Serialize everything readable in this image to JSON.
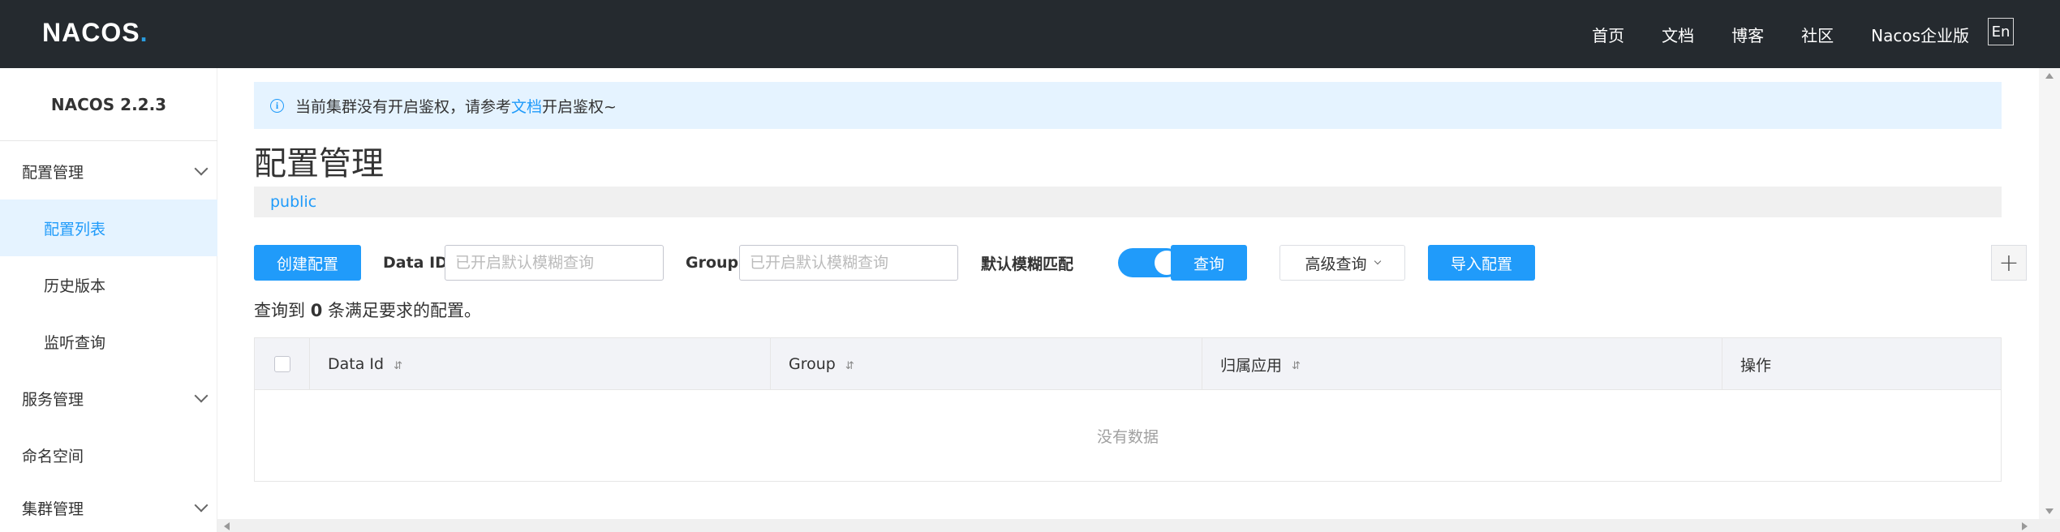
{
  "header": {
    "logo_prefix": "NACOS",
    "logo_suffix": ".",
    "nav": [
      "首页",
      "文档",
      "博客",
      "社区",
      "Nacos企业版"
    ],
    "lang_button": "En"
  },
  "sidebar": {
    "version": "NACOS 2.2.3",
    "items": [
      {
        "label": "配置管理",
        "type": "group",
        "expandable": true
      },
      {
        "label": "配置列表",
        "type": "item",
        "active": true
      },
      {
        "label": "历史版本",
        "type": "item"
      },
      {
        "label": "监听查询",
        "type": "item"
      },
      {
        "label": "服务管理",
        "type": "group",
        "expandable": true
      },
      {
        "label": "命名空间",
        "type": "group",
        "expandable": false
      },
      {
        "label": "集群管理",
        "type": "group",
        "expandable": true
      }
    ]
  },
  "notice": {
    "text_before": "当前集群没有开启鉴权，请参考",
    "link_text": "文档",
    "text_after": "开启鉴权~"
  },
  "page_title": "配置管理",
  "namespace": "public",
  "toolbar": {
    "create_label": "创建配置",
    "data_id_label": "Data ID",
    "data_id_placeholder": "已开启默认模糊查询",
    "group_label": "Group",
    "group_placeholder": "已开启默认模糊查询",
    "fuzzy_label": "默认模糊匹配",
    "fuzzy_on": true,
    "query_label": "查询",
    "advanced_label": "高级查询",
    "import_label": "导入配置",
    "plus_label": "+"
  },
  "result": {
    "prefix": "查询到",
    "count": "0",
    "suffix": "条满足要求的配置。"
  },
  "table": {
    "columns": [
      "Data Id",
      "Group",
      "归属应用",
      "操作"
    ],
    "sort_glyph": "⇵",
    "empty_text": "没有数据"
  },
  "colors": {
    "accent": "#209bfa",
    "header_bg": "#252a2f",
    "notice_bg": "#e5f3ff"
  }
}
